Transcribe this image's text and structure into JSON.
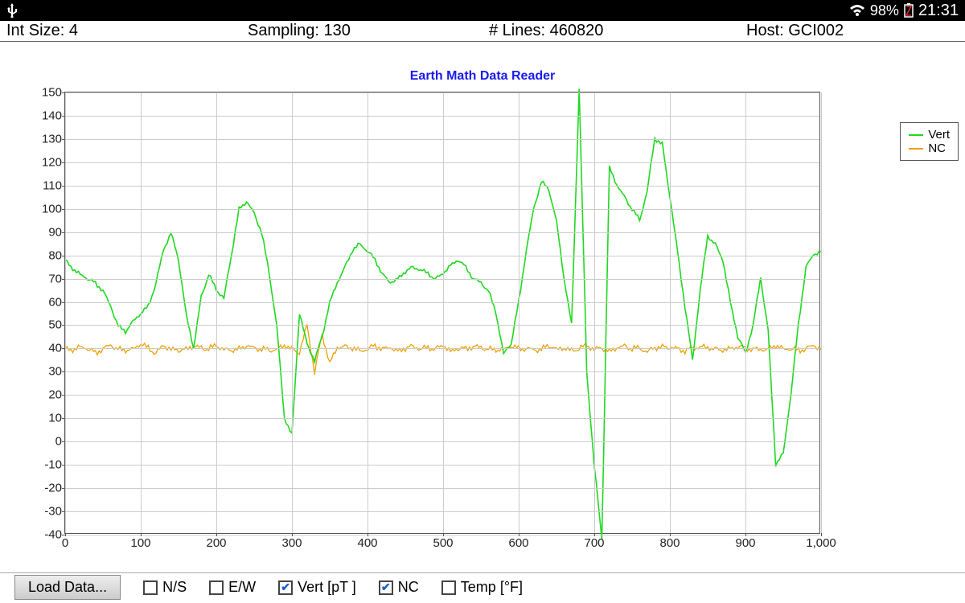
{
  "status_bar": {
    "battery_pct": "98%",
    "clock": "21:31"
  },
  "info_bar": {
    "int_size_label": "Int Size:",
    "int_size_value": "4",
    "sampling_label": "Sampling:",
    "sampling_value": "130",
    "lines_label": "# Lines:",
    "lines_value": "460820",
    "host_label": "Host:",
    "host_value": "GCI002"
  },
  "chart_title": "Earth Math Data Reader",
  "legend": {
    "vert": "Vert",
    "nc": "NC"
  },
  "colors": {
    "vert": "#1fd81f",
    "nc": "#f0a000"
  },
  "bottom": {
    "load": "Load Data...",
    "ns": "N/S",
    "ew": "E/W",
    "vert": "Vert [pT ]",
    "nc": "NC",
    "temp": "Temp [°F]",
    "ns_checked": false,
    "ew_checked": false,
    "vert_checked": true,
    "nc_checked": true,
    "temp_checked": false
  },
  "chart_data": {
    "type": "line",
    "title": "Earth Math Data Reader",
    "xlabel": "",
    "ylabel": "",
    "xlim": [
      0,
      1000
    ],
    "ylim": [
      -40,
      150
    ],
    "x_ticks": [
      0,
      100,
      200,
      300,
      400,
      500,
      600,
      700,
      800,
      900,
      1000
    ],
    "y_ticks": [
      -40,
      -30,
      -20,
      -10,
      0,
      10,
      20,
      30,
      40,
      50,
      60,
      70,
      80,
      90,
      100,
      110,
      120,
      130,
      140,
      150
    ],
    "x": [
      0,
      10,
      20,
      30,
      40,
      50,
      60,
      70,
      80,
      90,
      100,
      110,
      120,
      130,
      140,
      150,
      160,
      170,
      180,
      190,
      200,
      210,
      220,
      230,
      240,
      250,
      260,
      270,
      280,
      290,
      300,
      310,
      320,
      330,
      340,
      350,
      360,
      370,
      380,
      390,
      400,
      410,
      420,
      430,
      440,
      450,
      460,
      470,
      480,
      490,
      500,
      510,
      520,
      530,
      540,
      550,
      560,
      570,
      580,
      590,
      600,
      610,
      620,
      630,
      640,
      650,
      660,
      670,
      680,
      690,
      700,
      710,
      720,
      730,
      740,
      750,
      760,
      770,
      780,
      790,
      800,
      810,
      820,
      830,
      840,
      850,
      860,
      870,
      880,
      890,
      900,
      910,
      920,
      930,
      940,
      950,
      960,
      970,
      980,
      990,
      1000
    ],
    "series": [
      {
        "name": "Vert",
        "values": [
          78,
          74,
          72,
          70,
          68,
          65,
          58,
          50,
          47,
          52,
          55,
          58,
          68,
          82,
          90,
          78,
          55,
          40,
          62,
          72,
          65,
          62,
          80,
          100,
          103,
          98,
          90,
          72,
          50,
          10,
          3,
          55,
          42,
          35,
          45,
          60,
          68,
          75,
          82,
          85,
          82,
          78,
          72,
          68,
          70,
          73,
          75,
          74,
          72,
          70,
          72,
          76,
          78,
          75,
          70,
          68,
          65,
          55,
          38,
          42,
          60,
          82,
          100,
          112,
          108,
          95,
          70,
          50,
          152,
          30,
          -10,
          -42,
          118,
          110,
          105,
          100,
          95,
          108,
          130,
          128,
          105,
          82,
          58,
          35,
          65,
          88,
          85,
          78,
          60,
          45,
          38,
          50,
          70,
          48,
          -10,
          -5,
          20,
          50,
          75,
          80,
          82
        ]
      },
      {
        "name": "NC",
        "values": [
          40,
          39,
          41,
          40,
          38,
          40,
          41,
          40,
          39,
          40,
          42,
          40,
          38,
          41,
          40,
          39,
          40,
          41,
          40,
          40,
          41,
          40,
          39,
          40,
          41,
          40,
          40,
          39,
          40,
          41,
          40,
          38,
          50,
          30,
          46,
          34,
          40,
          41,
          40,
          39,
          40,
          41,
          40,
          40,
          39,
          40,
          41,
          40,
          40,
          40,
          41,
          39,
          40,
          40,
          41,
          40,
          40,
          39,
          40,
          41,
          40,
          40,
          39,
          40,
          41,
          40,
          40,
          39,
          40,
          41,
          40,
          40,
          39,
          40,
          41,
          40,
          40,
          39,
          40,
          41,
          40,
          40,
          39,
          40,
          41,
          40,
          40,
          39,
          40,
          41,
          40,
          40,
          39,
          40,
          41,
          40,
          40,
          39,
          40,
          41,
          40
        ]
      }
    ]
  }
}
